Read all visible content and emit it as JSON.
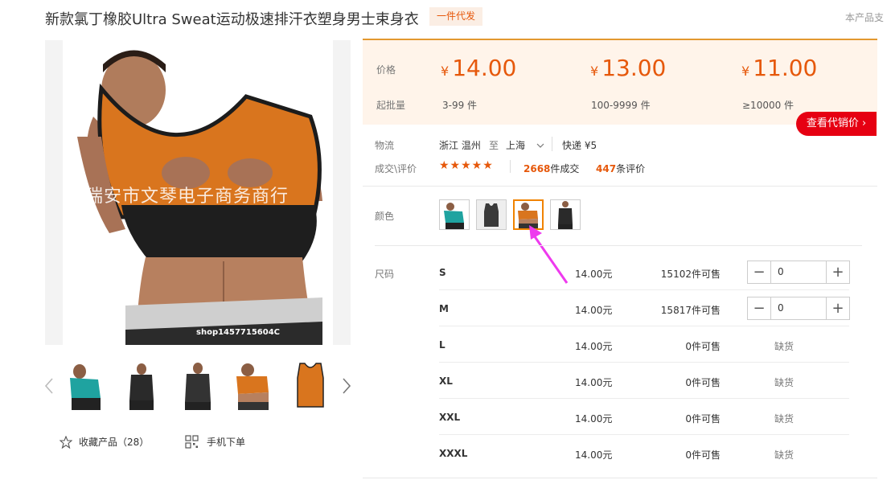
{
  "header": {
    "title": "新款氯丁橡胶Ultra Sweat运动极速排汗衣塑身男士束身衣",
    "tag": "一件代发",
    "right_text": "本产品支"
  },
  "gallery": {
    "watermark": "瑞安市文琴电子商务商行",
    "shop_code": "shop1457715604C",
    "favorite_label": "收藏产品（28）",
    "mobile_label": "手机下单"
  },
  "price": {
    "price_label": "价格",
    "batch_label": "起批量",
    "currency": "¥",
    "tiers": [
      {
        "price": "14.00",
        "range": "3-99 件"
      },
      {
        "price": "13.00",
        "range": "100-9999 件"
      },
      {
        "price": "11.00",
        "range": "≥10000 件"
      }
    ],
    "dist_button": "查看代销价 ›"
  },
  "logistics": {
    "label": "物流",
    "from": "浙江 温州",
    "to_word": "至",
    "to": "上海",
    "express": "快递 ¥5"
  },
  "deals": {
    "label": "成交\\评价",
    "stars": "★★★★★",
    "sold_count": "2668",
    "sold_suffix": "件成交",
    "review_count": "447",
    "review_suffix": "条评价"
  },
  "color": {
    "label": "颜色",
    "selected_index": 2
  },
  "size": {
    "label": "尺码",
    "unit_price_suffix": "元",
    "stock_suffix": "件可售",
    "out_of_stock": "缺货",
    "rows": [
      {
        "name": "S",
        "price": "14.00",
        "stock": "15102",
        "qty": "0"
      },
      {
        "name": "M",
        "price": "14.00",
        "stock": "15817",
        "qty": "0"
      },
      {
        "name": "L",
        "price": "14.00",
        "stock": "0"
      },
      {
        "name": "XL",
        "price": "14.00",
        "stock": "0"
      },
      {
        "name": "XXL",
        "price": "14.00",
        "stock": "0"
      },
      {
        "name": "XXXL",
        "price": "14.00",
        "stock": "0"
      }
    ]
  },
  "colors": {
    "accent": "#e6580b",
    "vest_orange": "#d9751e",
    "red_button": "#e60012",
    "pointer_arrow": "#ee3aee"
  }
}
